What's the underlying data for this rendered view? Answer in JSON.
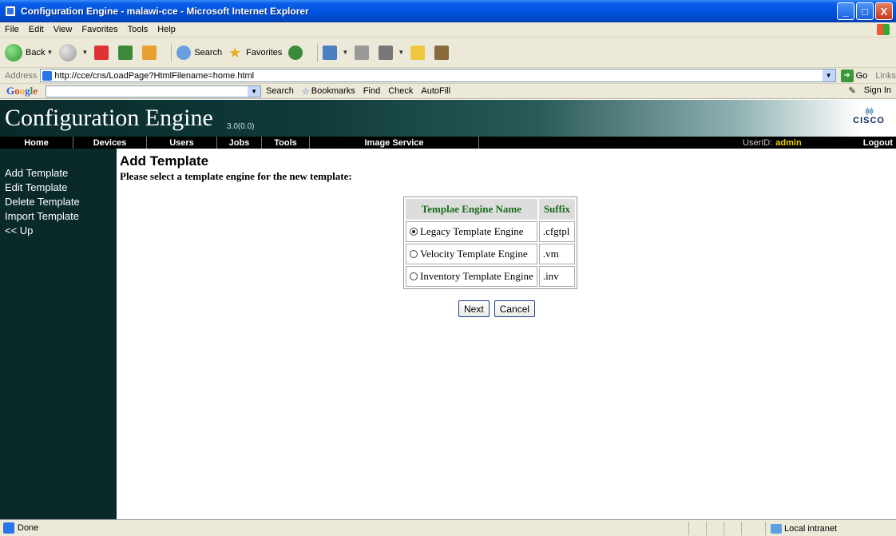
{
  "window": {
    "title": "Configuration Engine - malawi-cce - Microsoft Internet Explorer",
    "minimize": "_",
    "maximize": "□",
    "close": "X"
  },
  "menu": [
    "File",
    "Edit",
    "View",
    "Favorites",
    "Tools",
    "Help"
  ],
  "toolbar": {
    "back": "Back",
    "search": "Search",
    "favorites": "Favorites"
  },
  "address": {
    "label": "Address",
    "url": "http://cce/cns/LoadPage?HtmlFilename=home.html",
    "go": "Go",
    "links": "Links"
  },
  "googlebar": {
    "search": "Search",
    "bookmarks": "Bookmarks",
    "find": "Find",
    "check": "Check",
    "autofill": "AutoFill",
    "sign_in": "Sign In"
  },
  "header": {
    "title": "Configuration Engine",
    "version": "3.0(0.0)",
    "brand": "CISCO"
  },
  "nav": {
    "items": [
      "Home",
      "Devices",
      "Users",
      "Jobs",
      "Tools",
      "Image Service"
    ],
    "userid_label": "UserID:",
    "userid": "admin",
    "logout": "Logout"
  },
  "sidebar": {
    "items": [
      "Add Template",
      "Edit Template",
      "Delete Template",
      "Import Template",
      "<< Up"
    ]
  },
  "main": {
    "heading": "Add Template",
    "subtitle": "Please select a template engine for the new template:",
    "table": {
      "headers": [
        "Templae Engine Name",
        "Suffix"
      ],
      "rows": [
        {
          "name": "Legacy Template Engine",
          "suffix": ".cfgtpl",
          "selected": true
        },
        {
          "name": "Velocity Template Engine",
          "suffix": ".vm",
          "selected": false
        },
        {
          "name": "Inventory Template Engine",
          "suffix": ".inv",
          "selected": false
        }
      ]
    },
    "next": "Next",
    "cancel": "Cancel"
  },
  "status": {
    "text": "Done",
    "zone": "Local intranet"
  }
}
